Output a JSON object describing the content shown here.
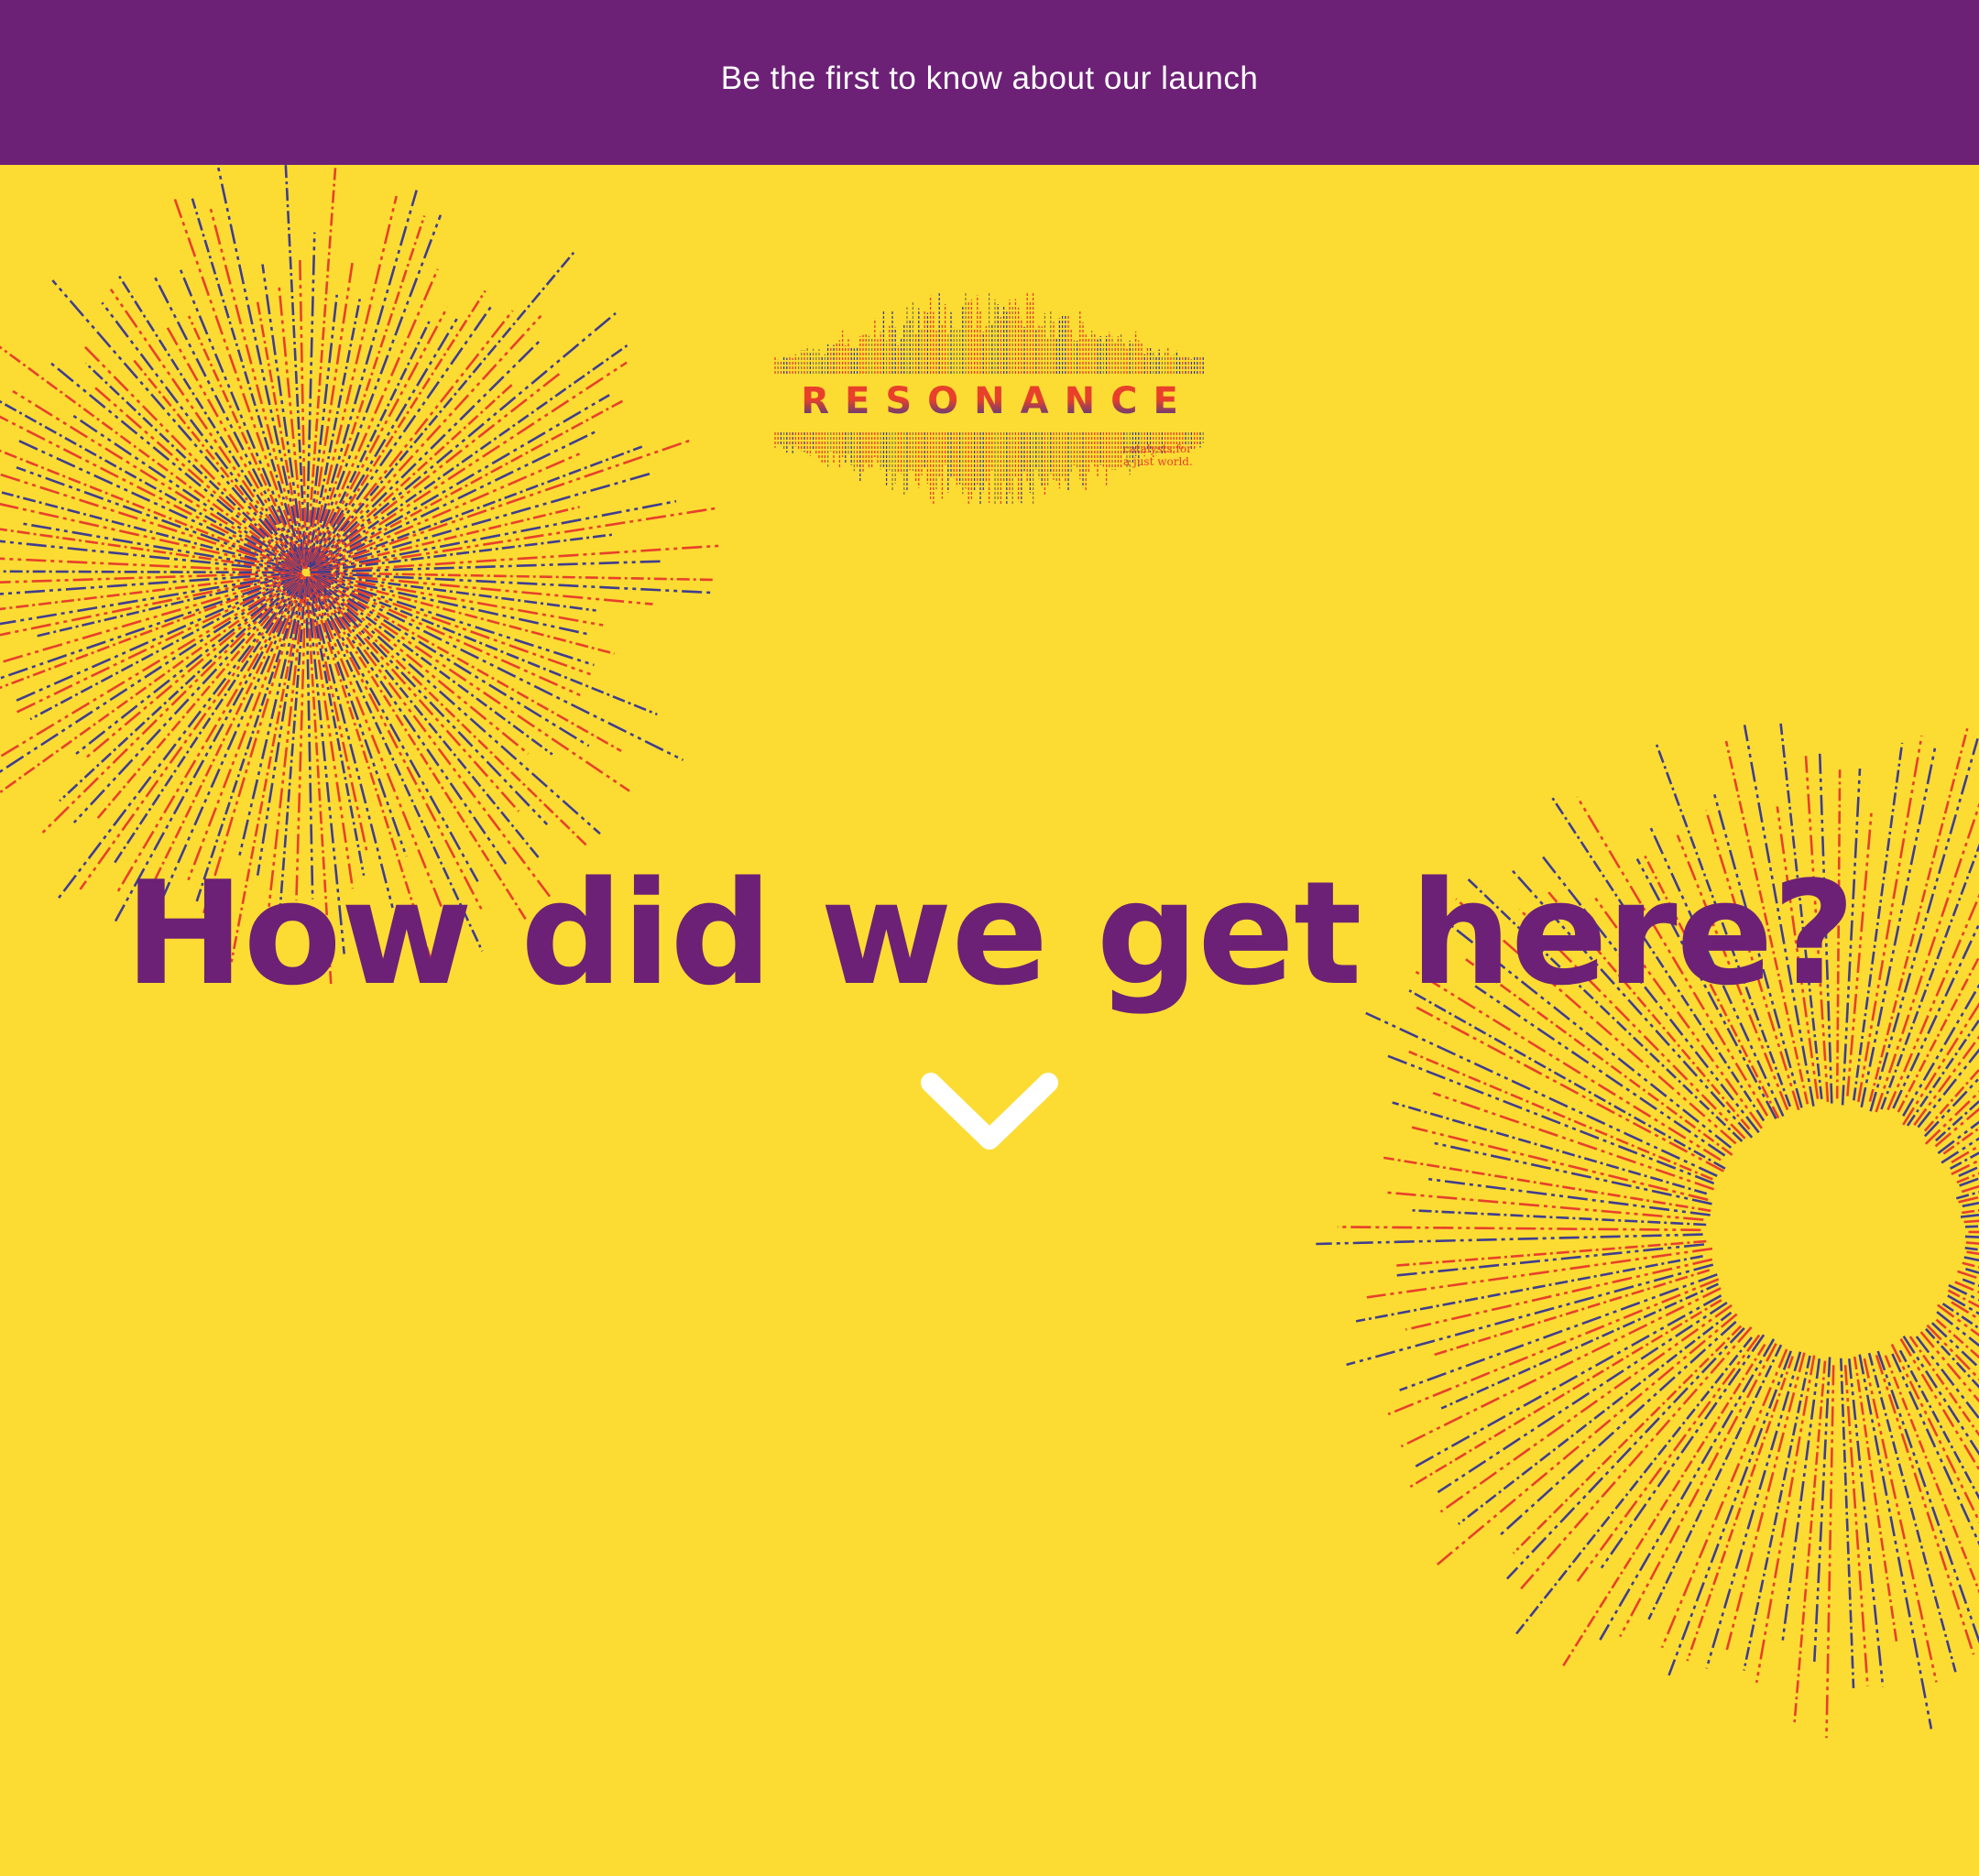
{
  "banner": {
    "text": "Be the first to know about our launch"
  },
  "logo": {
    "wordmark": "RESONANCE",
    "tagline_line1": "catalysts for",
    "tagline_line2": "a just world."
  },
  "hero": {
    "headline": "How did we get here?"
  },
  "icons": {
    "scroll_down": "chevron-down-icon"
  },
  "colors": {
    "background": "#FCDC33",
    "banner": "#6C2176",
    "headline": "#6C2176",
    "ray_red": "#E8402A",
    "ray_blue": "#3F3D8F",
    "chevron": "#FFFFFF"
  }
}
